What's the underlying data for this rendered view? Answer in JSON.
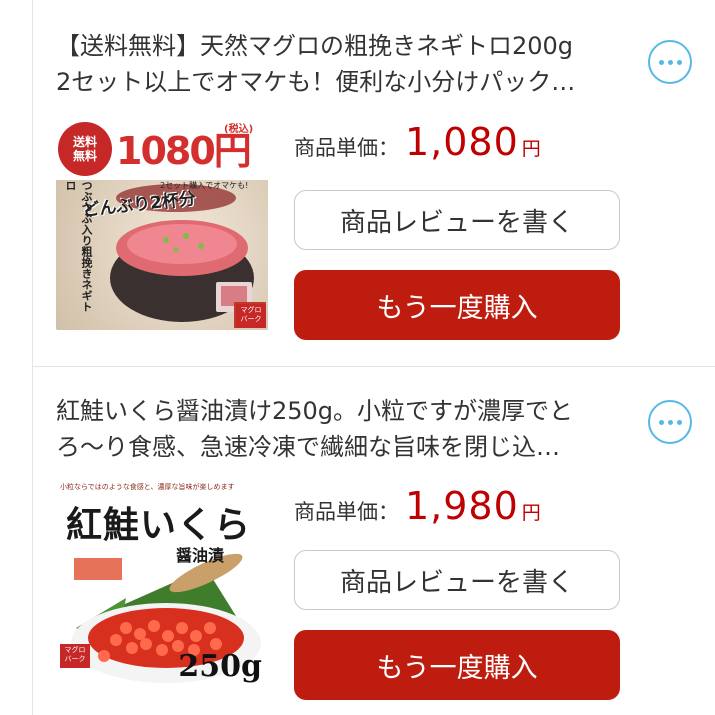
{
  "items": [
    {
      "title_line1": "【送料無料】天然マグロの粗挽きネギトロ200g",
      "title_line2": "2セット以上でオマケも！便利な小分けパック…",
      "price_label": "商品単価：",
      "price_value": "1,080",
      "price_unit": "円",
      "review_label": "商品レビューを書く",
      "buy_label": "もう一度購入",
      "image": {
        "badge_top": "送料",
        "badge_bottom": "無料",
        "price_big": "1080円",
        "tax_note": "(税込)",
        "set_note": "2セット購入でオマケも!",
        "catch": "どんぶり2杯分",
        "vertical_text": "つぶつぶ入り粗挽きネギトロ",
        "shop_mark": "マグロ\nバーク"
      }
    },
    {
      "title_line1": "紅鮭いくら醤油漬け250g。小粒ですが濃厚でと",
      "title_line2": "ろ～り食感、急速冷凍で繊細な旨味を閉じ込…",
      "price_label": "商品単価：",
      "price_value": "1,980",
      "price_unit": "円",
      "review_label": "商品レビューを書く",
      "buy_label": "もう一度購入",
      "image": {
        "top_note": "小粒ならではのような食感と、濃厚な旨味が楽しめます",
        "name": "紅鮭いくら",
        "sub": "醤油漬",
        "weight": "250g",
        "shop_mark": "マグロ\nバーク"
      }
    }
  ],
  "colors": {
    "accent_red": "#bf1c10",
    "price_red": "#bf0000",
    "icon_blue": "#56b8e6"
  }
}
